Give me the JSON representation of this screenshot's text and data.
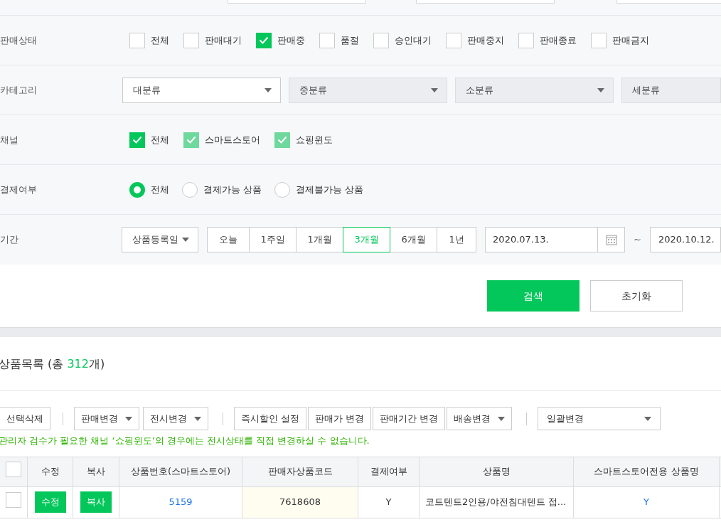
{
  "filters": [
    {
      "kind": "checkboxes",
      "label": "판매상태",
      "options": [
        {
          "label": "전체",
          "checked": false
        },
        {
          "label": "판매대기",
          "checked": false
        },
        {
          "label": "판매중",
          "checked": true
        },
        {
          "label": "품절",
          "checked": false
        },
        {
          "label": "승인대기",
          "checked": false
        },
        {
          "label": "판매중지",
          "checked": false
        },
        {
          "label": "판매종료",
          "checked": false
        },
        {
          "label": "판매금지",
          "checked": false
        }
      ]
    },
    {
      "kind": "selects",
      "label": "카테고리",
      "selects": [
        {
          "label": "대분류",
          "disabled": false
        },
        {
          "label": "중분류",
          "disabled": true
        },
        {
          "label": "소분류",
          "disabled": true
        },
        {
          "label": "세분류",
          "disabled": true
        }
      ]
    },
    {
      "kind": "checkboxes",
      "label": "채널",
      "options": [
        {
          "label": "전체",
          "checked": true,
          "disabled": false
        },
        {
          "label": "스마트스토어",
          "checked": true,
          "disabled": true
        },
        {
          "label": "쇼핑윈도",
          "checked": true,
          "disabled": true
        }
      ]
    },
    {
      "kind": "radios",
      "label": "결제여부",
      "options": [
        {
          "label": "전체",
          "selected": true
        },
        {
          "label": "결제가능 상품",
          "selected": false
        },
        {
          "label": "결제불가능 상품",
          "selected": false
        }
      ]
    },
    {
      "kind": "period",
      "label": "기간",
      "select": "상품등록일",
      "ranges": [
        {
          "label": "오늘",
          "selected": false
        },
        {
          "label": "1주일",
          "selected": false
        },
        {
          "label": "1개월",
          "selected": false
        },
        {
          "label": "3개월",
          "selected": true
        },
        {
          "label": "6개월",
          "selected": false
        },
        {
          "label": "1년",
          "selected": false
        }
      ],
      "start_date": "2020.07.13.",
      "range_separator": "~",
      "end_date": "2020.10.12."
    }
  ],
  "actions": [
    {
      "label": "검색",
      "kind": "primary"
    },
    {
      "label": "초기화",
      "kind": "secondary"
    }
  ],
  "products": {
    "title": "상품목록 (총 ",
    "count": "312",
    "title_end": "개)"
  },
  "toolbar": [
    {
      "kind": "button",
      "label": "선택삭제"
    },
    {
      "kind": "separator"
    },
    {
      "kind": "dropdown",
      "label": "판매변경"
    },
    {
      "kind": "dropdown",
      "label": "전시변경"
    },
    {
      "kind": "separator"
    },
    {
      "kind": "button",
      "label": "즉시할인 설정"
    },
    {
      "kind": "button",
      "label": "판매가 변경"
    },
    {
      "kind": "button",
      "label": "판매기간 변경"
    },
    {
      "kind": "dropdown",
      "label": "배송변경"
    },
    {
      "kind": "separator"
    },
    {
      "kind": "select",
      "label": "일괄변경"
    }
  ],
  "notice": "관리자 검수가 필요한 채널 ‘쇼핑윈도’의 경우에는 전시상태를 직접 변경하실 수 없습니다.",
  "table": {
    "all_checked": false,
    "columns": [
      "수정",
      "복사",
      "상품번호(스마트스토어)",
      "판매자상품코드",
      "결제여부",
      "상품명",
      "스마트스토어전용 상품명"
    ],
    "rows": [
      {
        "checked": false,
        "edit": "수정",
        "copy": "복사",
        "product_no": "5159",
        "seller_code": "7618608",
        "payment": "Y",
        "name": "코트텐트2인용/야전침대텐트 접...",
        "store_name": "Y"
      }
    ]
  }
}
